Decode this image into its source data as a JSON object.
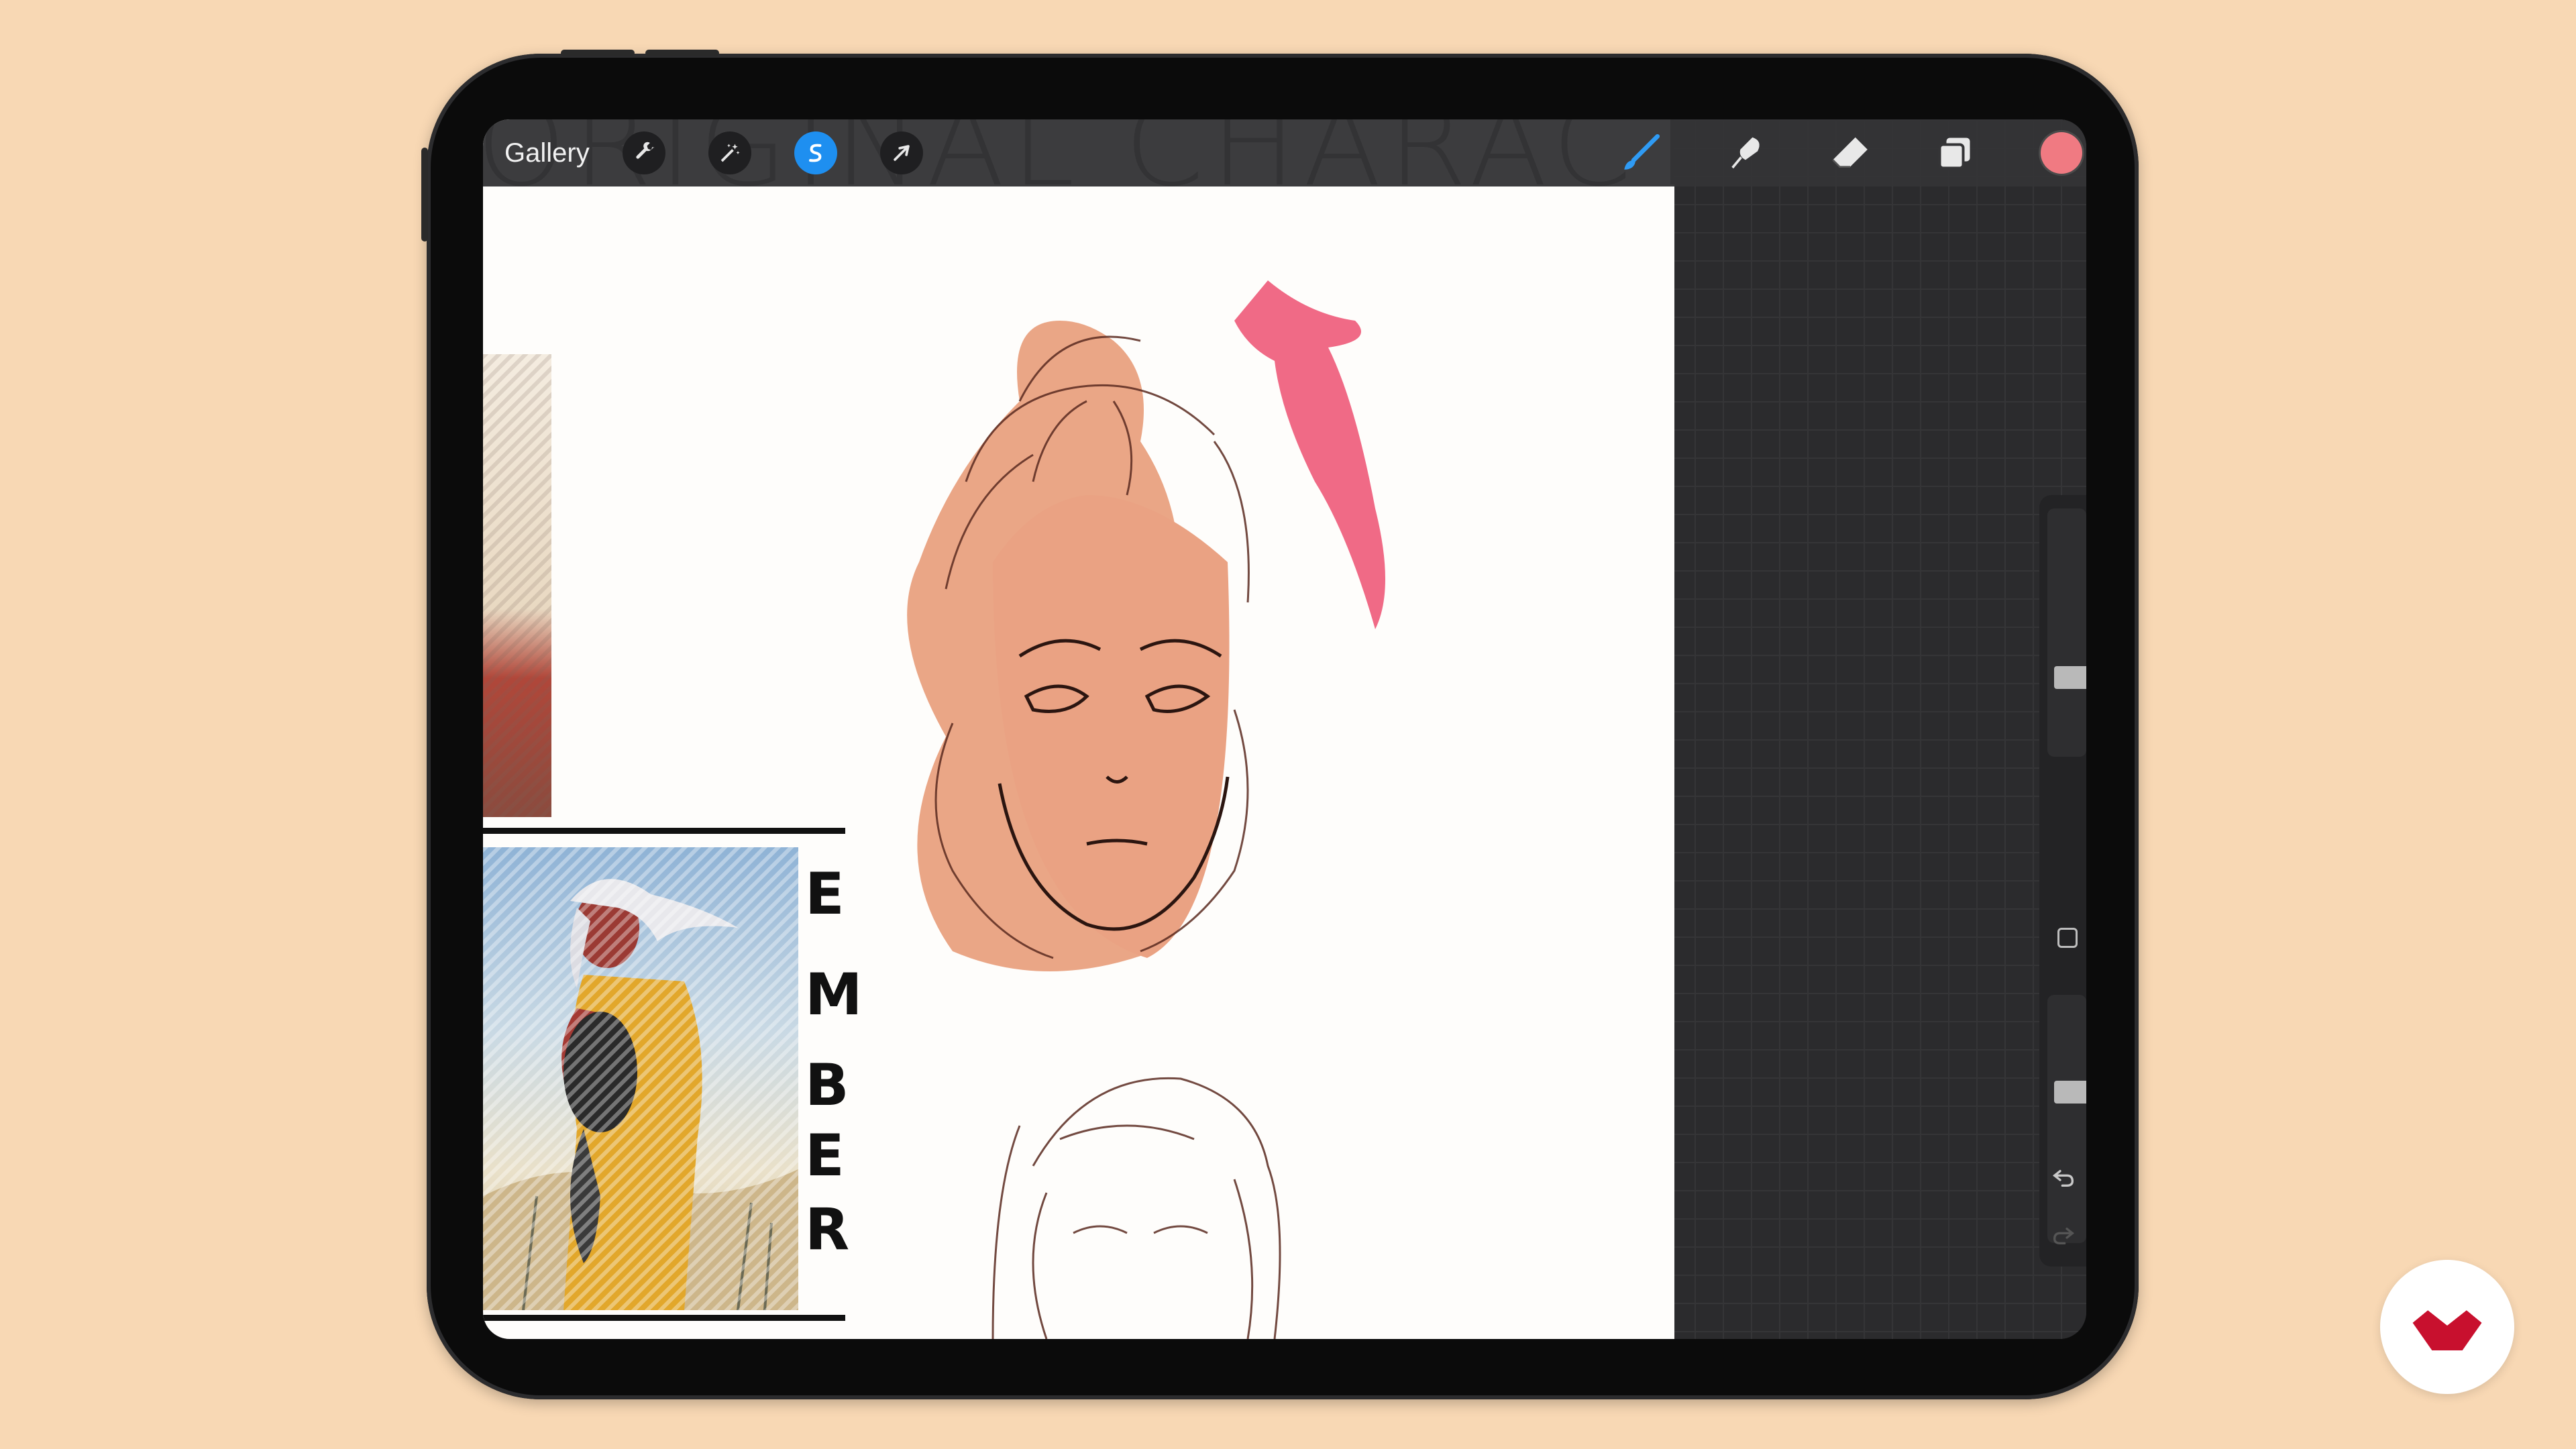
{
  "toolbar": {
    "gallery_label": "Gallery",
    "left_tools": [
      {
        "name": "actions",
        "icon": "wrench-icon"
      },
      {
        "name": "adjustments",
        "icon": "magic-wand-icon"
      },
      {
        "name": "selection",
        "icon": "selection-s-icon",
        "active": true
      },
      {
        "name": "transform",
        "icon": "arrow-cursor-icon"
      }
    ],
    "right_tools": [
      {
        "name": "brush",
        "icon": "brush-icon",
        "active": true
      },
      {
        "name": "smudge",
        "icon": "smudge-icon"
      },
      {
        "name": "eraser",
        "icon": "eraser-icon"
      },
      {
        "name": "layers",
        "icon": "layers-icon"
      }
    ],
    "current_color": "#f07a82"
  },
  "canvas": {
    "title_text": "ORIGINAL CHARACTER!",
    "vertical_letters": [
      "E",
      "M",
      "B",
      "E",
      "R"
    ]
  },
  "sidebar": {
    "brush_size_level": 0.3,
    "opacity_level": 0.62,
    "undo_icon": "undo-icon",
    "redo_icon": "redo-icon"
  },
  "colors": {
    "background": "#f8d8b4",
    "accent_blue": "#1e8ff0",
    "skin": "#e9a17f",
    "hair_pink": "#f06a86",
    "brand_red": "#c8102e"
  },
  "brand": {
    "icon": "brand-logo-icon"
  }
}
